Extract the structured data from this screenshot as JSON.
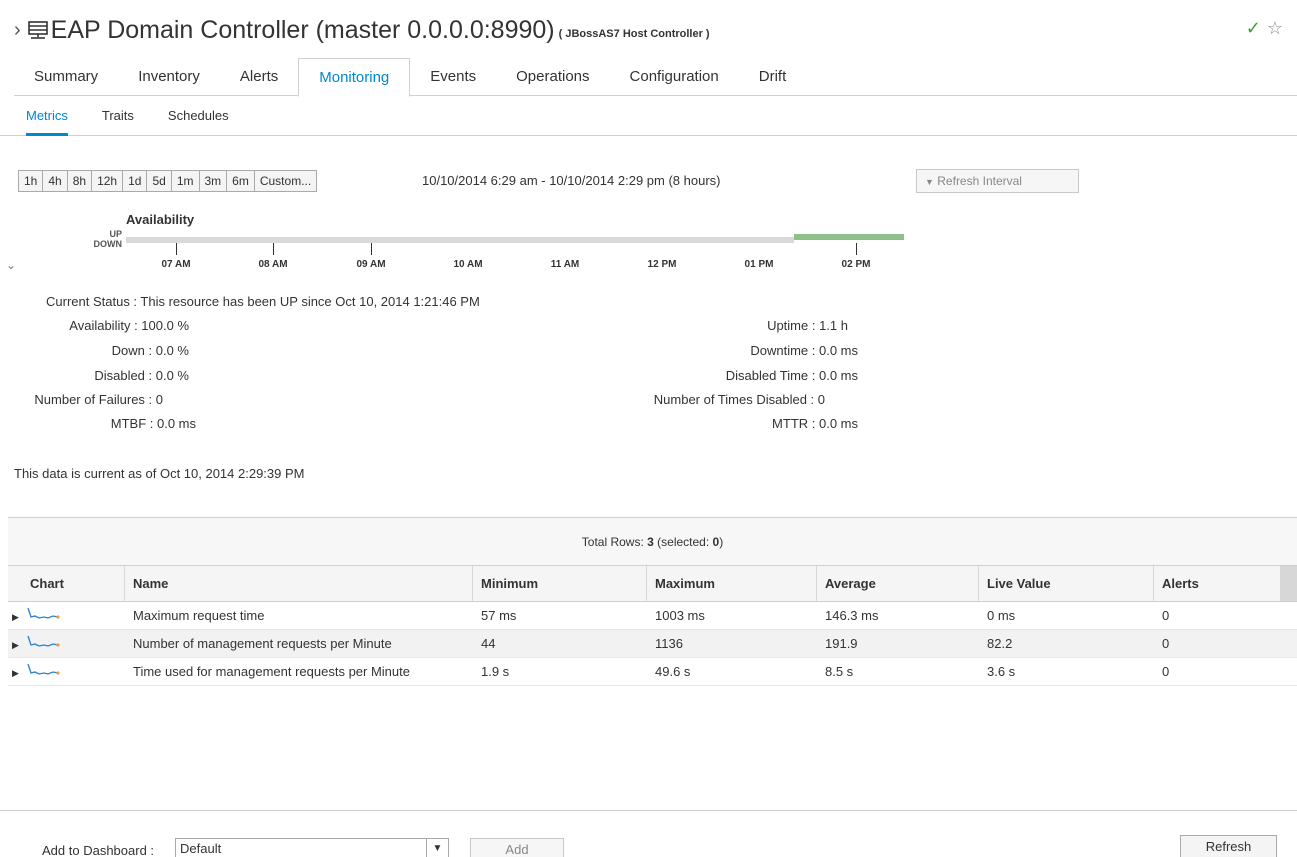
{
  "header": {
    "title": "EAP Domain Controller (master 0.0.0.0:8990)",
    "subtitle": "( JBossAS7 Host Controller )",
    "icons": {
      "breadcrumb": "chevron-right-icon",
      "resource": "server-icon",
      "status": "check-circle-icon",
      "favorite": "star-icon"
    },
    "status_color": "#3f9c35"
  },
  "tabs": [
    "Summary",
    "Inventory",
    "Alerts",
    "Monitoring",
    "Events",
    "Operations",
    "Configuration",
    "Drift"
  ],
  "active_tab": "Monitoring",
  "subtabs": [
    "Metrics",
    "Traits",
    "Schedules"
  ],
  "active_subtab": "Metrics",
  "range_buttons": [
    "1h",
    "4h",
    "8h",
    "12h",
    "1d",
    "5d",
    "1m",
    "3m",
    "6m",
    "Custom..."
  ],
  "range_text": "10/10/2014 6:29 am - 10/10/2014 2:29 pm (8 hours)",
  "refresh_interval": "Refresh Interval",
  "availability_chart": {
    "title": "Availability",
    "up_label": "UP",
    "down_label": "DOWN",
    "ticks": [
      "07 AM",
      "08 AM",
      "09 AM",
      "10 AM",
      "11 AM",
      "12 PM",
      "01 PM",
      "02 PM"
    ],
    "up_color": "#8dc08a",
    "unknown_color": "#d9d9d9"
  },
  "stats": {
    "current_status": "Current Status : This resource has been UP since Oct 10, 2014 1:21:46 PM",
    "availability": "Availability : 100.0 %",
    "down": "Down : 0.0 %",
    "disabled": "Disabled : 0.0 %",
    "failures": "Number of Failures : 0",
    "mtbf": "MTBF : 0.0 ms",
    "uptime": "Uptime : 1.1 h",
    "downtime": "Downtime : 0.0 ms",
    "disabled_time": "Disabled Time : 0.0 ms",
    "times_disabled": "Number of Times Disabled : 0",
    "mttr": "MTTR : 0.0 ms"
  },
  "current_as_of": "This data is current as of Oct 10, 2014 2:29:39 PM",
  "grid": {
    "total_rows_label": "Total Rows: ",
    "total_rows": "3",
    "selected_label": " (selected: ",
    "selected": "0",
    "selected_close": ")",
    "columns": [
      "Chart",
      "Name",
      "Minimum",
      "Maximum",
      "Average",
      "Live Value",
      "Alerts"
    ],
    "rows": [
      {
        "name": "Maximum request time",
        "min": "57 ms",
        "max": "1003 ms",
        "avg": "146.3 ms",
        "live": "0 ms",
        "alerts": "0"
      },
      {
        "name": "Number of management requests per Minute",
        "min": "44",
        "max": "1136",
        "avg": "191.9",
        "live": "82.2",
        "alerts": "0"
      },
      {
        "name": "Time used for management requests per Minute",
        "min": "1.9 s",
        "max": "49.6 s",
        "avg": "8.5 s",
        "live": "3.6 s",
        "alerts": "0"
      }
    ]
  },
  "footer": {
    "dashboard_label": "Add to Dashboard :",
    "dashboard_value": "Default",
    "add_label": "Add",
    "refresh_label": "Refresh"
  }
}
